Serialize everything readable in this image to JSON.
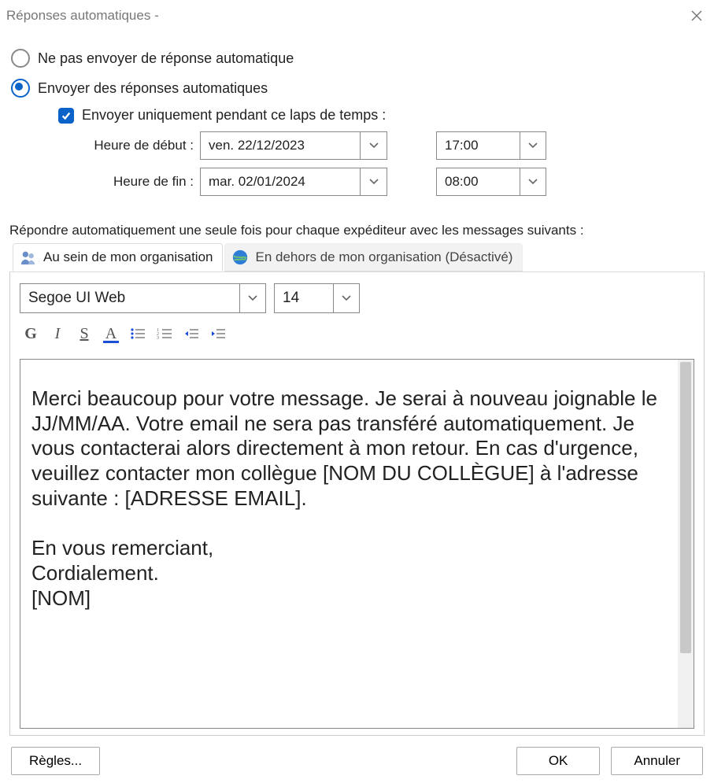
{
  "title": "Réponses automatiques -",
  "radios": {
    "no_send": "Ne pas envoyer de réponse automatique",
    "send": "Envoyer des réponses automatiques"
  },
  "time_range": {
    "checkbox_label": "Envoyer uniquement pendant ce laps de temps :",
    "start_label": "Heure de début :",
    "end_label": "Heure de fin :",
    "start_date": "ven. 22/12/2023",
    "start_time": "17:00",
    "end_date": "mar. 02/01/2024",
    "end_time": "08:00"
  },
  "reply_info": "Répondre automatiquement une seule fois pour chaque expéditeur avec les messages suivants :",
  "tabs": {
    "internal": "Au sein de mon organisation",
    "external": "En dehors de mon organisation (Désactivé)"
  },
  "editor": {
    "font_name": "Segoe UI Web",
    "font_size": "14",
    "message": "Merci beaucoup pour votre message. Je serai à nouveau joignable le JJ/MM/AA. Votre email ne sera pas transféré automatiquement. Je vous contacterai alors directement à mon retour. En cas d'urgence, veuillez contacter mon collègue [NOM DU COLLÈGUE] à l'adresse suivante : [ADRESSE EMAIL].\n\nEn vous remerciant,\nCordialement.\n[NOM]"
  },
  "footer": {
    "rules": "Règles...",
    "ok": "OK",
    "cancel": "Annuler"
  }
}
